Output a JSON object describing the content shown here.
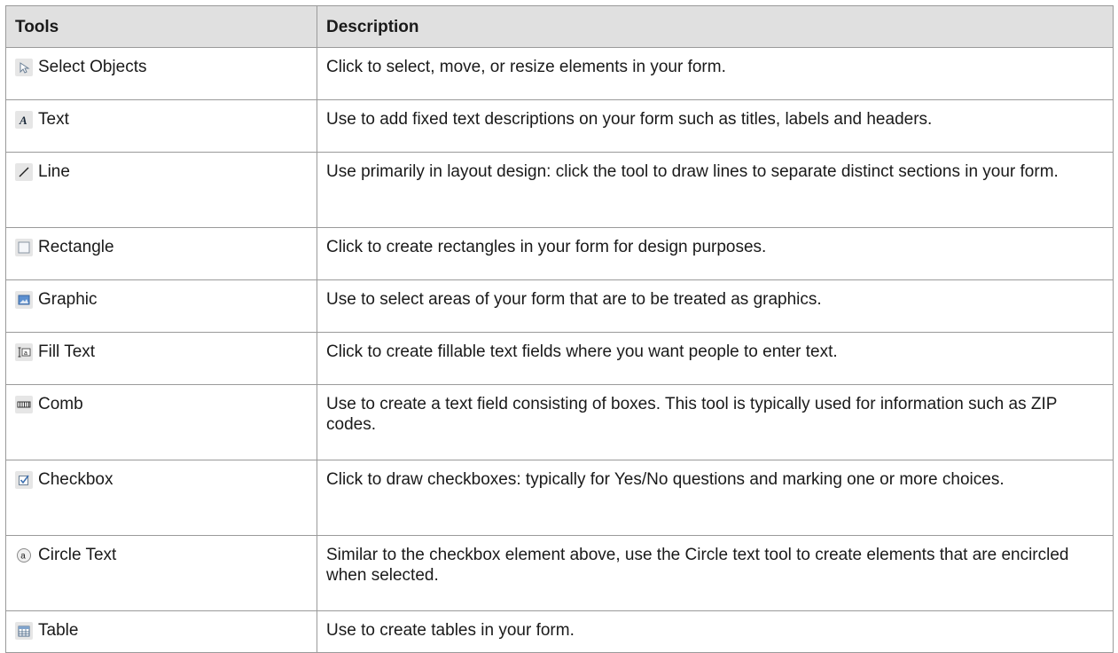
{
  "table": {
    "headers": {
      "tools": "Tools",
      "description": "Description"
    },
    "rows": [
      {
        "icon": "select-arrow-icon",
        "tool": "Select Objects",
        "description": "Click to select, move, or resize elements in your form."
      },
      {
        "icon": "text-a-icon",
        "tool": "Text",
        "description": "Use to add fixed text descriptions on your form such as titles, labels and headers."
      },
      {
        "icon": "line-icon",
        "tool": "Line",
        "description": "Use primarily in layout design: click the tool to draw lines to separate distinct sections in your form."
      },
      {
        "icon": "rectangle-icon",
        "tool": "Rectangle",
        "description": "Click to create rectangles in your form for design purposes."
      },
      {
        "icon": "graphic-icon",
        "tool": "Graphic",
        "description": "Use to select areas of your form that are to be treated as graphics."
      },
      {
        "icon": "fill-text-icon",
        "tool": "Fill Text",
        "description": "Click to create fillable text fields where you want people to enter text."
      },
      {
        "icon": "comb-icon",
        "tool": "Comb",
        "description": "Use to create a text field consisting of boxes. This tool is typically used for information such as ZIP codes."
      },
      {
        "icon": "checkbox-icon",
        "tool": "Checkbox",
        "description": "Click to draw checkboxes: typically for Yes/No questions and marking one or more choices."
      },
      {
        "icon": "circle-text-icon",
        "tool": "Circle Text",
        "description": "Similar to the checkbox element above, use the Circle text tool to create elements that are encircled when selected."
      },
      {
        "icon": "table-icon",
        "tool": "Table",
        "description": "Use to create tables in your form."
      }
    ]
  }
}
